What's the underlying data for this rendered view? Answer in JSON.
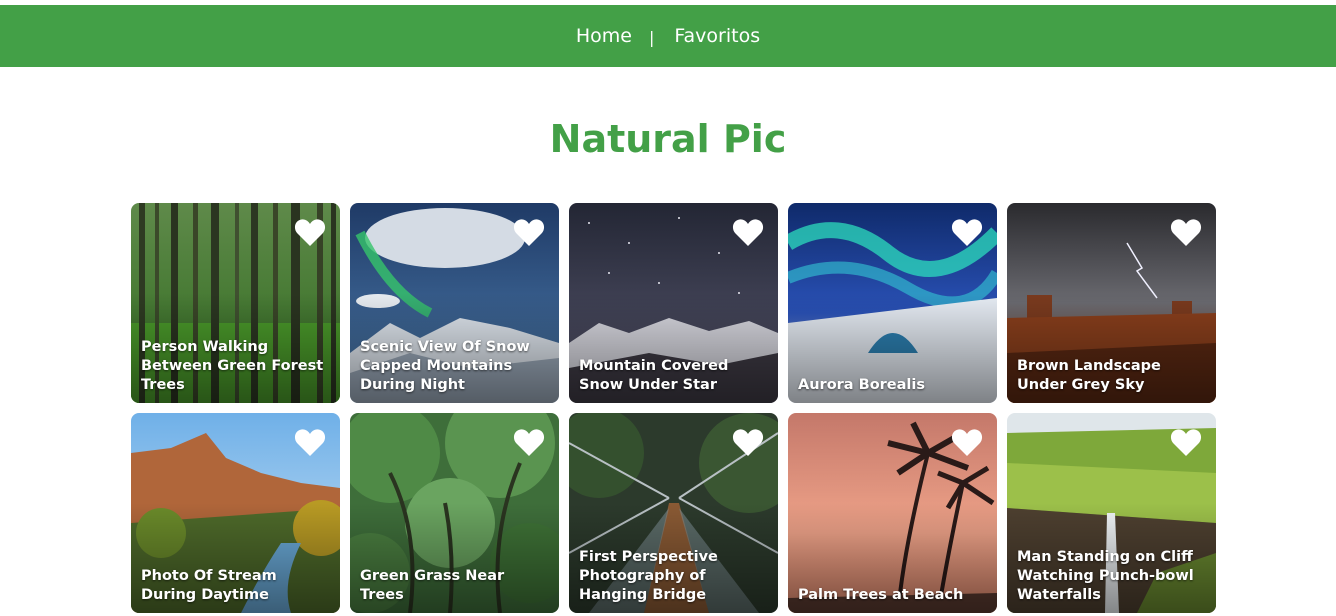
{
  "nav": {
    "home": "Home",
    "separator": "|",
    "favorites": "Favoritos"
  },
  "page_title": "Natural Pic",
  "photos": [
    {
      "caption": "Person Walking Between Green Forest Trees",
      "scene": "forest"
    },
    {
      "caption": "Scenic View Of Snow Capped Mountains During Night",
      "scene": "snow-night"
    },
    {
      "caption": "Mountain Covered Snow Under Star",
      "scene": "stars"
    },
    {
      "caption": "Aurora Borealis",
      "scene": "aurora"
    },
    {
      "caption": "Brown Landscape Under Grey Sky",
      "scene": "desert"
    },
    {
      "caption": "Photo Of Stream During Daytime",
      "scene": "stream"
    },
    {
      "caption": "Green Grass Near Trees",
      "scene": "trees"
    },
    {
      "caption": "First Perspective Photography of Hanging Bridge",
      "scene": "bridge"
    },
    {
      "caption": "Palm Trees at Beach",
      "scene": "palms"
    },
    {
      "caption": "Man Standing on Cliff Watching Punch-bowl Waterfalls",
      "scene": "waterfall"
    }
  ],
  "colors": {
    "accent": "#43a047",
    "heart": "#ffffff"
  }
}
